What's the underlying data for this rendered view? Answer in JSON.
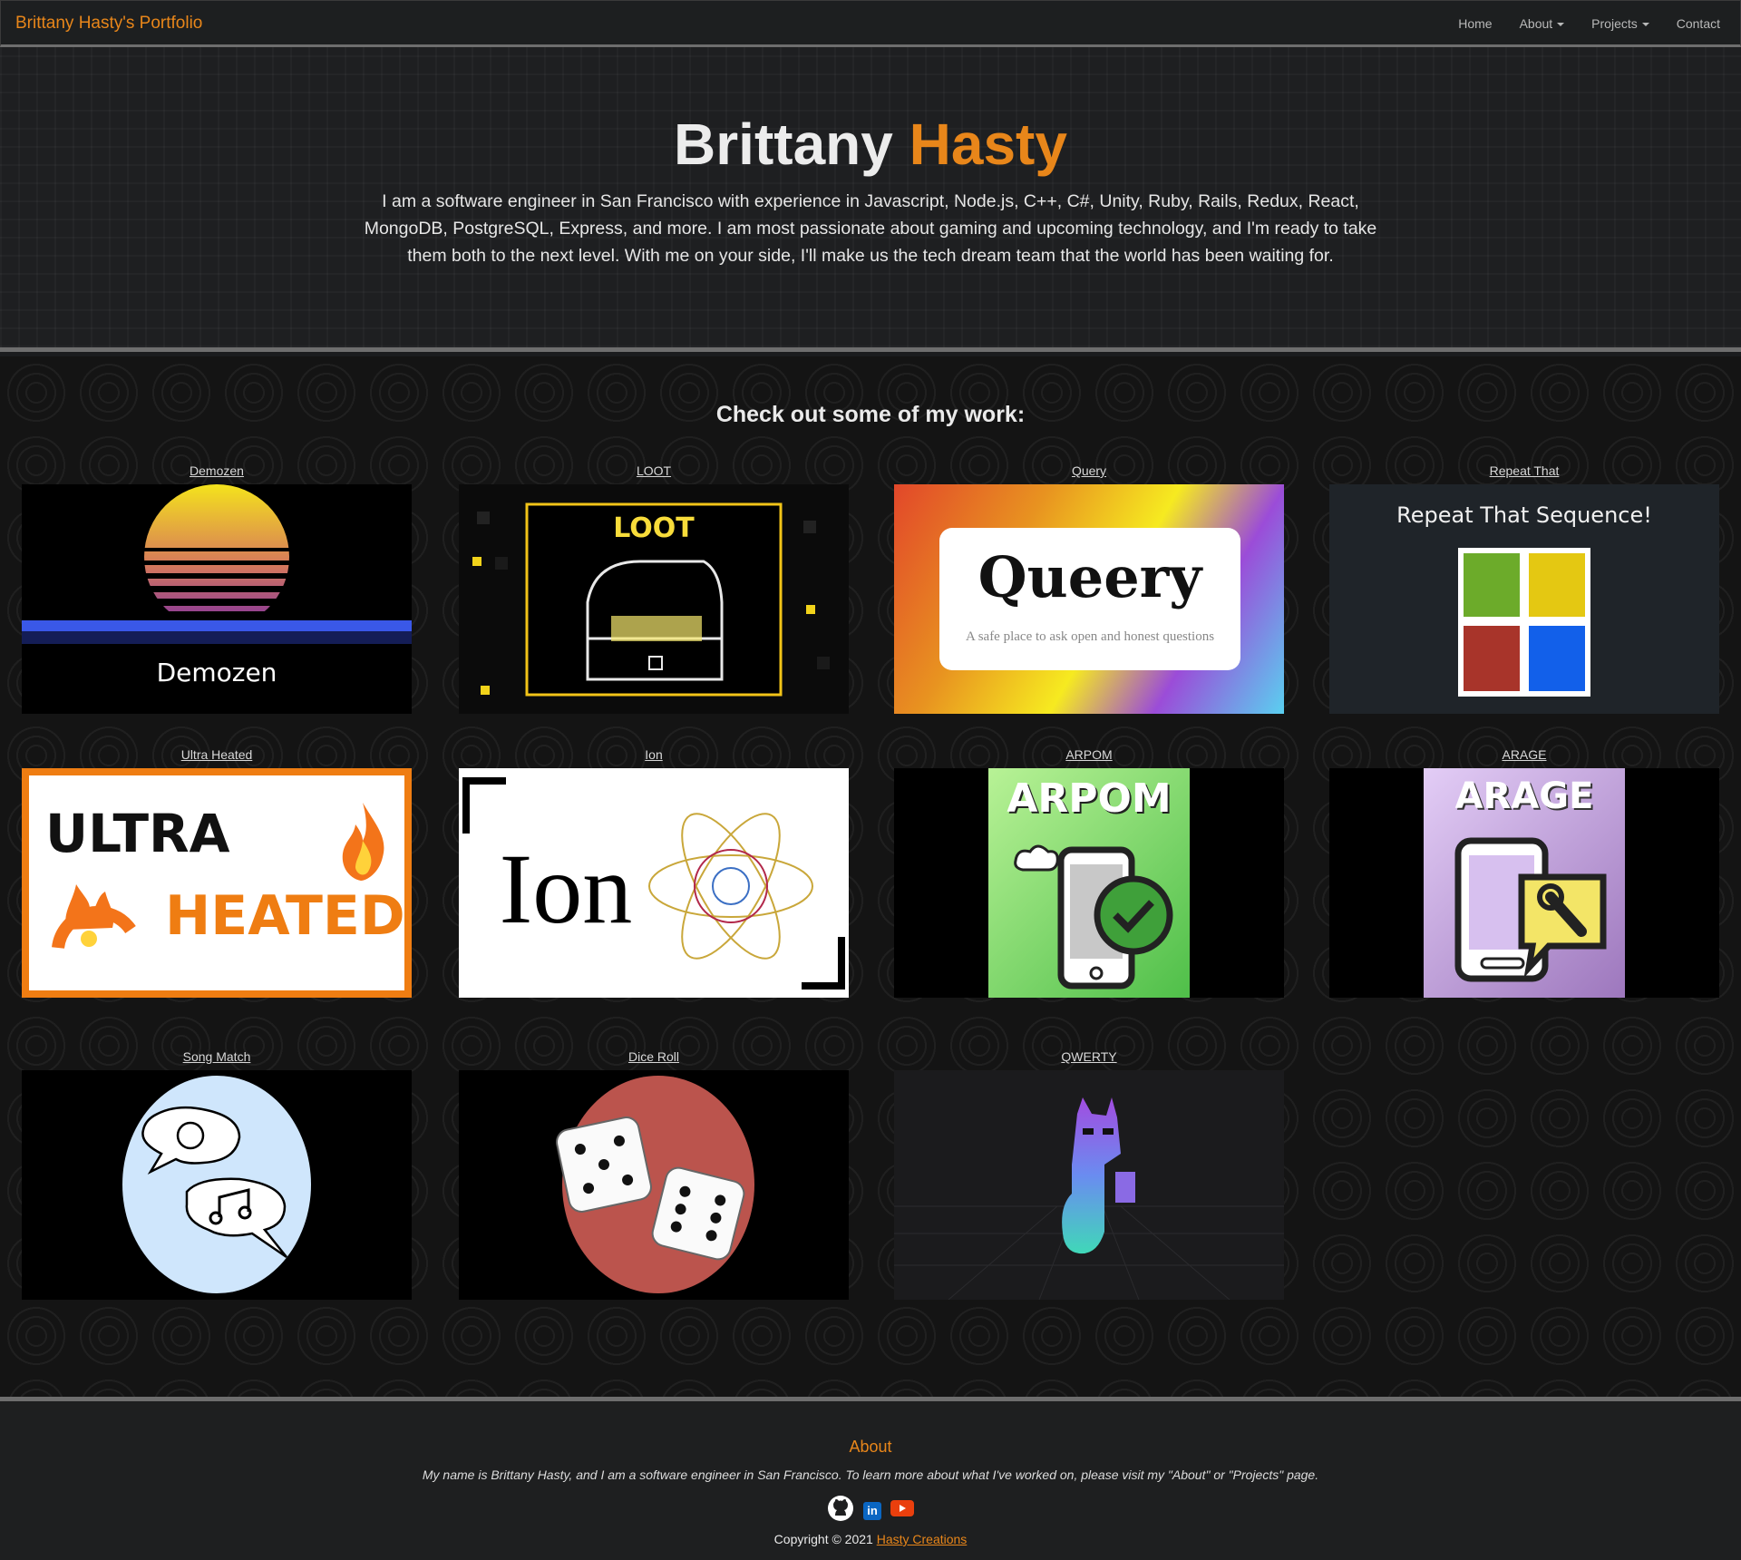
{
  "nav": {
    "brand": "Brittany Hasty's Portfolio",
    "links": [
      {
        "label": "Home"
      },
      {
        "label": "About"
      },
      {
        "label": "Projects"
      },
      {
        "label": "Contact"
      }
    ]
  },
  "hero": {
    "first_name": "Brittany",
    "last_name": "Hasty",
    "intro": "I am a software engineer in San Francisco with experience in Javascript, Node.js, C++, C#, Unity, Ruby, Rails, Redux, React, MongoDB, PostgreSQL, Express, and more. I am most passionate about gaming and upcoming technology, and I'm ready to take them both to the next level. With me on your side, I'll make us the tech dream team that the world has been waiting for."
  },
  "work": {
    "heading": "Check out some of my work:",
    "projects": [
      {
        "title": "Demozen",
        "thumb_text": "Demozen"
      },
      {
        "title": "LOOT",
        "thumb_text": "LOOT"
      },
      {
        "title": "Query",
        "thumb_title": "Queery",
        "thumb_subtitle": "A safe place to ask open and honest questions"
      },
      {
        "title": "Repeat That",
        "thumb_text": "Repeat That Sequence!"
      },
      {
        "title": "Ultra Heated",
        "thumb_line1": "ULTRA",
        "thumb_line2": "HEATED"
      },
      {
        "title": "Ion",
        "thumb_text": "Ion"
      },
      {
        "title": "ARPOM",
        "thumb_text": "ARPOM"
      },
      {
        "title": "ARAGE",
        "thumb_text": "ARAGE"
      },
      {
        "title": "Song Match"
      },
      {
        "title": "Dice Roll"
      },
      {
        "title": "QWERTY"
      }
    ]
  },
  "footer": {
    "title": "About",
    "text": "My name is Brittany Hasty, and I am a software engineer in San Francisco. To learn more about what I've worked on, please visit my \"About\" or \"Projects\" page.",
    "icons": [
      "github-icon",
      "linkedin-icon",
      "youtube-icon"
    ],
    "linkedin_glyph": "in",
    "copyright_prefix": "Copyright © 2021",
    "copyright_link": "Hasty Creations"
  },
  "colors": {
    "accent": "#e8861a",
    "nav_bg": "#1d1f20",
    "divider": "#6e6e6e"
  }
}
